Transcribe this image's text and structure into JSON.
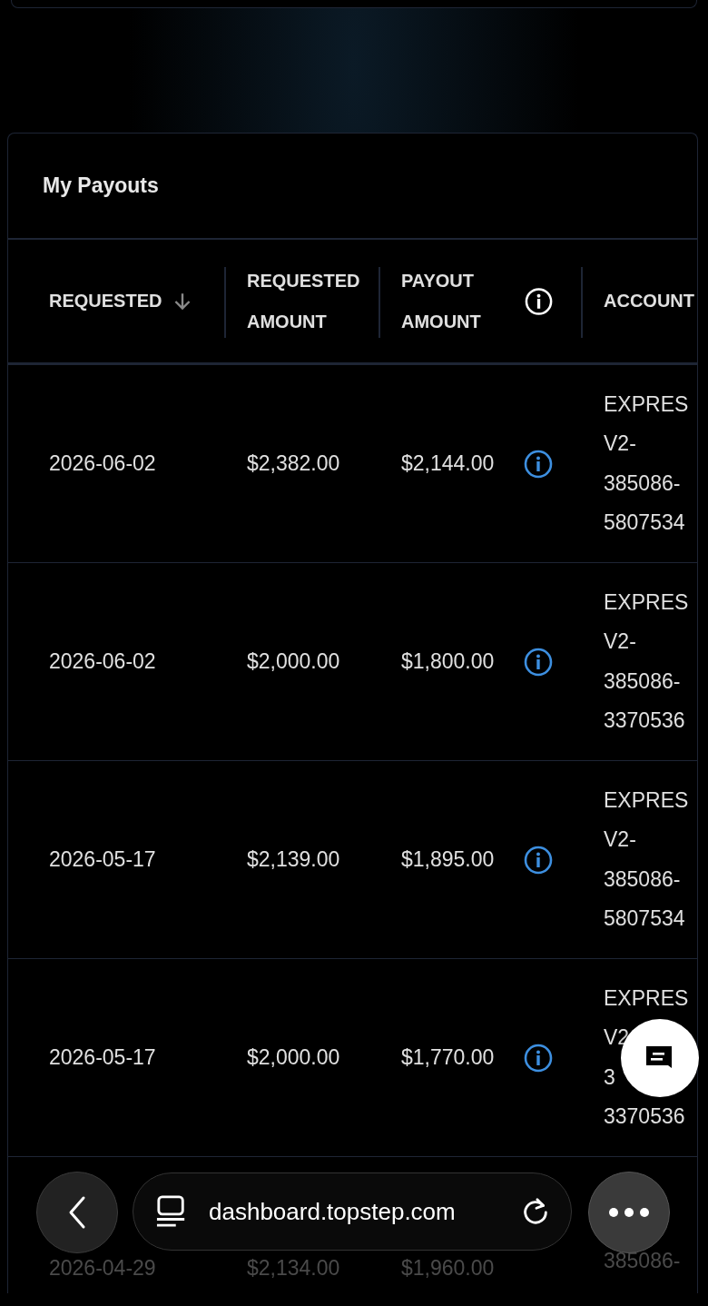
{
  "card": {
    "title": "My Payouts"
  },
  "table": {
    "columns": [
      {
        "label": "REQUESTED",
        "sorted": true
      },
      {
        "label": "REQUESTED AMOUNT",
        "sorted": false
      },
      {
        "label": "PAYOUT AMOUNT",
        "sorted": false
      },
      {
        "label": "ACCOUNT",
        "sorted": false
      }
    ],
    "rows": [
      {
        "requested": "2026-06-02",
        "requested_amount": "$2,382.00",
        "payout_amount": "$2,144.00",
        "account": [
          "EXPRES",
          "V2-",
          "385086-",
          "5807534"
        ],
        "dimmed": false
      },
      {
        "requested": "2026-06-02",
        "requested_amount": "$2,000.00",
        "payout_amount": "$1,800.00",
        "account": [
          "EXPRES",
          "V2-",
          "385086-",
          "3370536"
        ],
        "dimmed": false
      },
      {
        "requested": "2026-05-17",
        "requested_amount": "$2,139.00",
        "payout_amount": "$1,895.00",
        "account": [
          "EXPRES",
          "V2-",
          "385086-",
          "5807534"
        ],
        "dimmed": false
      },
      {
        "requested": "2026-05-17",
        "requested_amount": "$2,000.00",
        "payout_amount": "$1,770.00",
        "account": [
          "EXPRES",
          "V2",
          "3",
          "3370536"
        ],
        "dimmed": false
      },
      {
        "requested": "2026-04-29",
        "requested_amount": "$2,134.00",
        "payout_amount": "$1,960.00",
        "account": [
          "385086-"
        ],
        "dimmed": true
      }
    ]
  },
  "browser_bar": {
    "url": "dashboard.topstep.com"
  }
}
